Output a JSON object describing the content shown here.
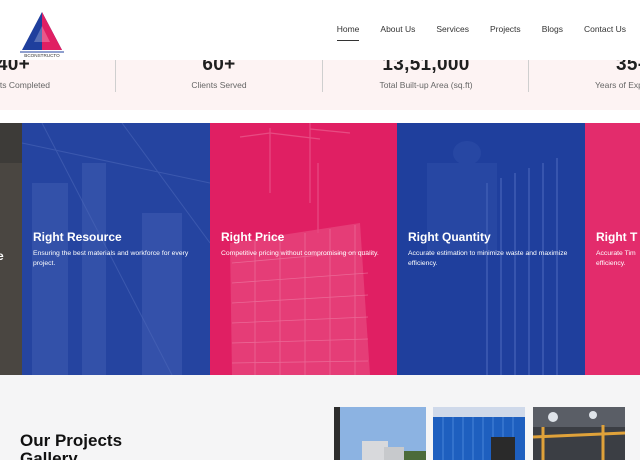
{
  "nav": {
    "logo_text": "BCONSTRUCTO",
    "items": [
      "Home",
      "About Us",
      "Services",
      "Projects",
      "Blogs",
      "Contact Us"
    ],
    "active": "Home"
  },
  "stats": [
    {
      "value": "40+",
      "label": "ts Completed"
    },
    {
      "value": "60+",
      "label": "Clients Served"
    },
    {
      "value": "13,51,000",
      "label": "Total Built-up Area (sq.ft)"
    },
    {
      "value": "35-",
      "label": "Years of Exp"
    }
  ],
  "cards": [
    {
      "title": "e",
      "desc": ""
    },
    {
      "title": "Right Resource",
      "desc": "Ensuring the best materials and workforce for every project."
    },
    {
      "title": "Right Price",
      "desc": "Competitive pricing without compromising on quality."
    },
    {
      "title": "Right Quantity",
      "desc": "Accurate estimation to minimize waste and maximize efficiency."
    },
    {
      "title": "Right T",
      "desc": "Accurate Tim efficiency."
    }
  ],
  "gallery": {
    "title_line1": "Our Projects",
    "title_line2": "Gallery"
  },
  "colors": {
    "blue": "#1f3f9d",
    "pink": "#e01f63",
    "stats_bg": "#fdf3f3"
  }
}
